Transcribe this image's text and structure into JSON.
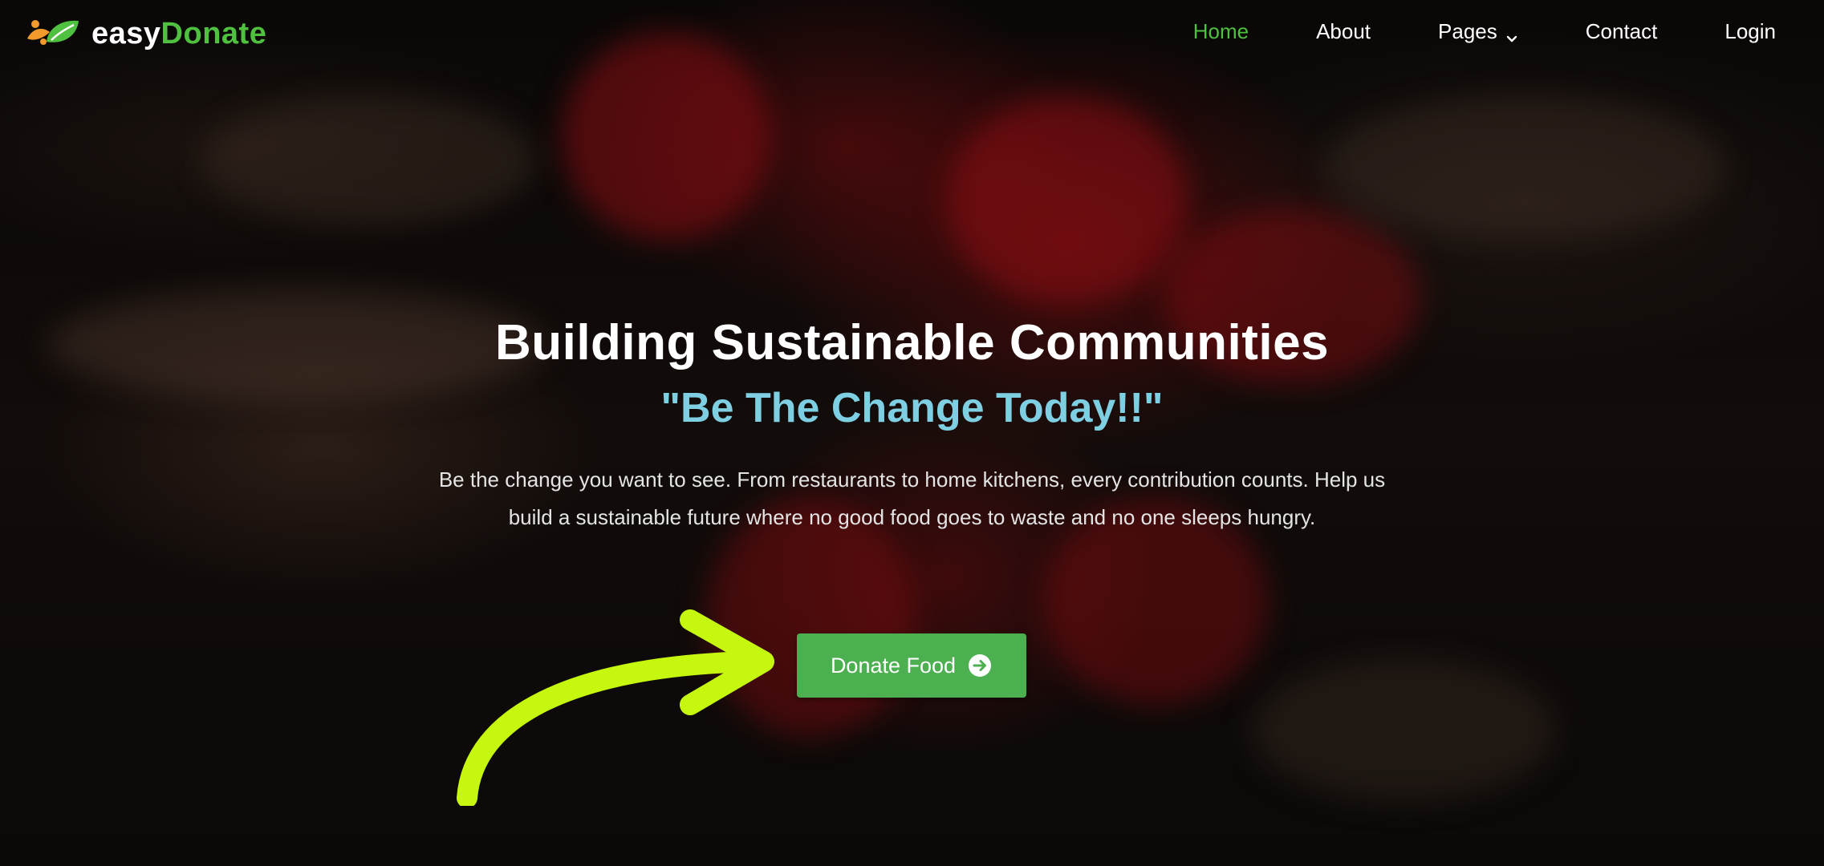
{
  "brand": {
    "name_part1": "easy",
    "name_part2": "Donate",
    "accent_color": "#4fc03f"
  },
  "nav": {
    "items": [
      {
        "label": "Home",
        "active": true
      },
      {
        "label": "About",
        "active": false
      },
      {
        "label": "Pages",
        "active": false,
        "has_dropdown": true
      },
      {
        "label": "Contact",
        "active": false
      },
      {
        "label": "Login",
        "active": false
      }
    ],
    "dropdown_icon": "chevron-down-icon"
  },
  "hero": {
    "title": "Building Sustainable Communities",
    "subtitle": "\"Be The Change Today!!\"",
    "description": "Be the change you want to see. From restaurants to home kitchens, every contribution counts. Help us build a sustainable future where no good food goes to waste and no one sleeps hungry.",
    "cta_label": "Donate Food",
    "cta_icon": "arrow-right-circle-icon",
    "cta_color": "#4caf50",
    "subtitle_color": "#7fcfe3",
    "annotation_icon": "curved-arrow-icon",
    "annotation_color": "#c6f70f"
  }
}
